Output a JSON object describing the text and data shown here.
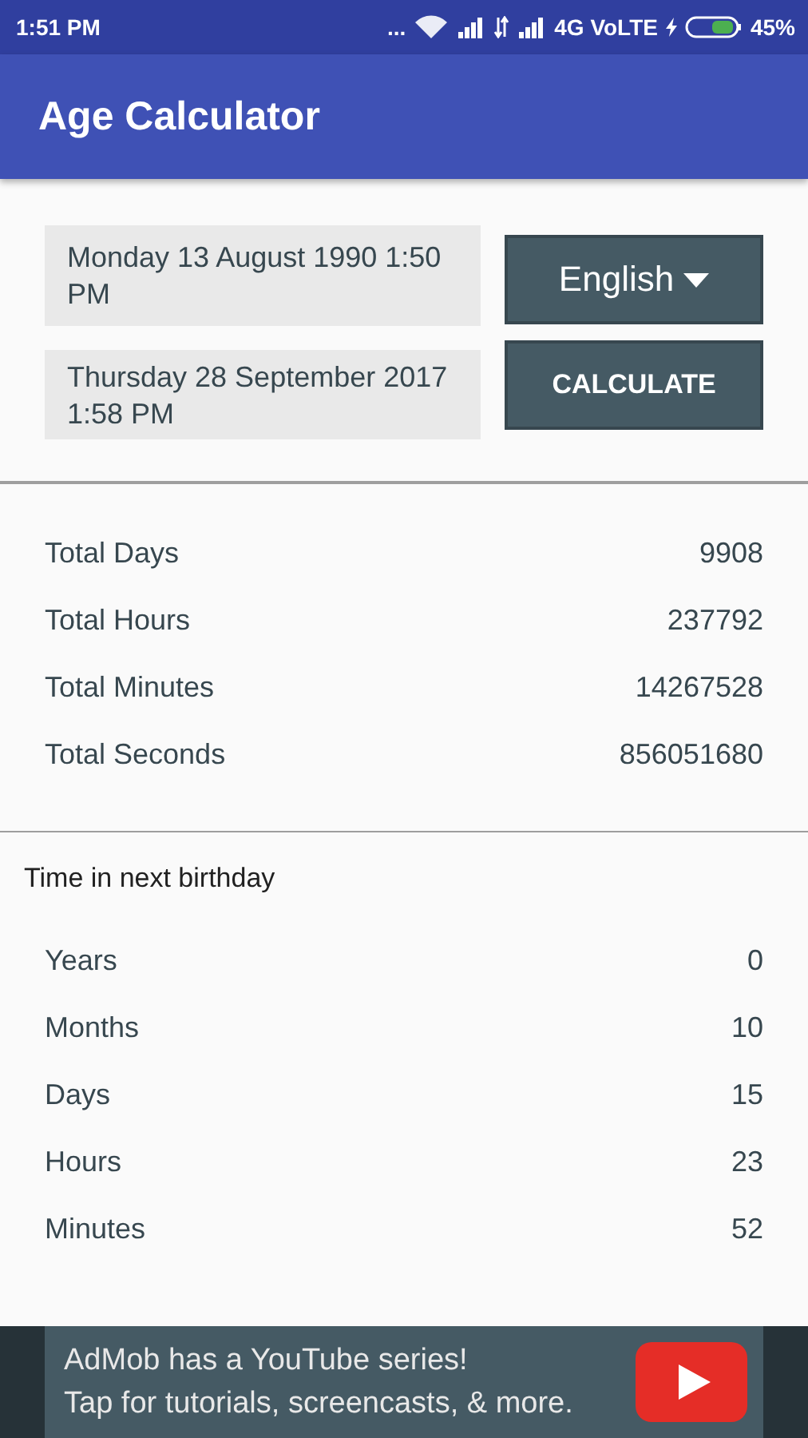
{
  "status_bar": {
    "time": "1:51 PM",
    "dots": "...",
    "network": "4G VoLTE",
    "battery": "45%"
  },
  "app_bar": {
    "title": "Age Calculator"
  },
  "inputs": {
    "dates": [
      "Monday 13 August 1990 1:50 PM",
      "Thursday 28 September 2017 1:58 PM"
    ],
    "language": "English",
    "calculate": "CALCULATE"
  },
  "totals": [
    {
      "label": "Total Days",
      "value": "9908"
    },
    {
      "label": "Total Hours",
      "value": "237792"
    },
    {
      "label": "Total Minutes",
      "value": "14267528"
    },
    {
      "label": "Total Seconds",
      "value": "856051680"
    }
  ],
  "next_birthday": {
    "heading": "Time in next birthday",
    "rows": [
      {
        "label": "Years",
        "value": "0"
      },
      {
        "label": "Months",
        "value": "10"
      },
      {
        "label": "Days",
        "value": "15"
      },
      {
        "label": "Hours",
        "value": "23"
      },
      {
        "label": "Minutes",
        "value": "52"
      }
    ]
  },
  "ad": {
    "lines": [
      "AdMob has a YouTube series!",
      "Tap for tutorials, screencasts, & more."
    ]
  }
}
